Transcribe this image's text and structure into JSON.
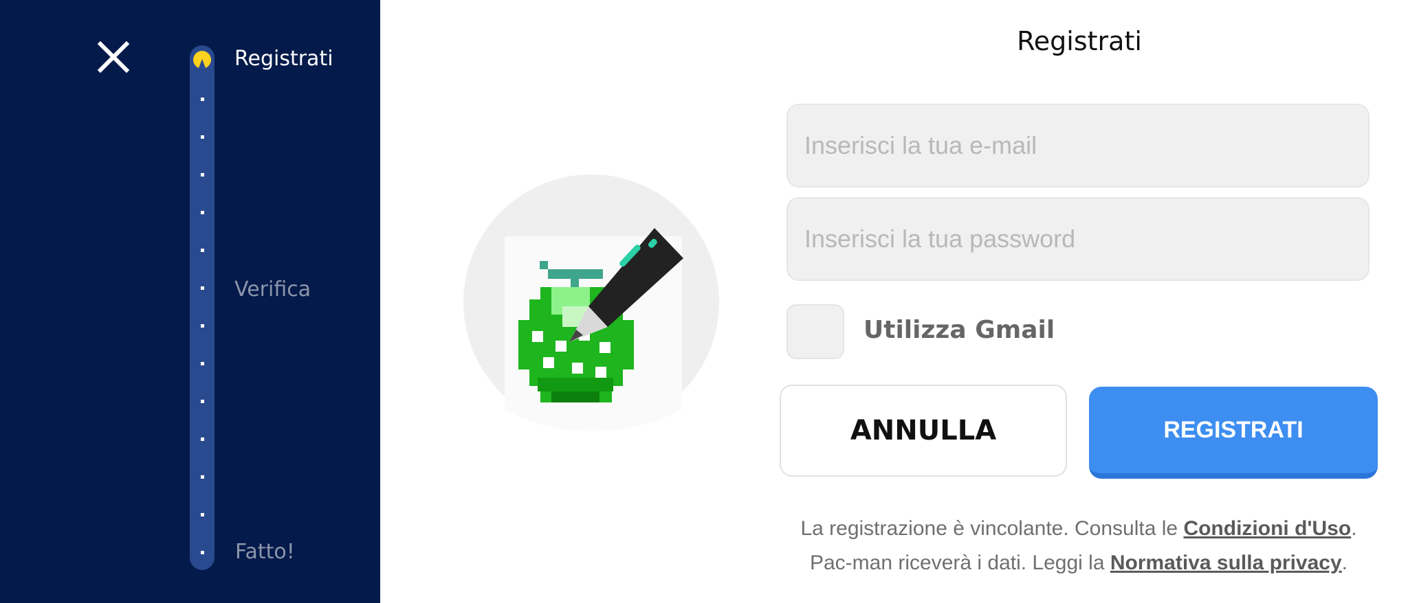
{
  "colors": {
    "sidebar_bg": "#041a4a",
    "track": "#2a4a8f",
    "pacman": "#ffd21f",
    "primary_button": "#3d8ef0",
    "field_bg": "#f0f0f0"
  },
  "sidebar": {
    "close_icon": "close-icon",
    "steps": [
      {
        "label": "Registrati",
        "state": "active"
      },
      {
        "label": "Verifica",
        "state": "pending"
      },
      {
        "label": "Fatto!",
        "state": "pending"
      }
    ]
  },
  "main": {
    "title": "Registrati",
    "illustration_icon": "pixel-melon-with-pen-icon",
    "form": {
      "email_placeholder": "Inserisci la tua e-mail",
      "email_value": "",
      "password_placeholder": "Inserisci la tua password",
      "password_value": "",
      "gmail_label": "Utilizza Gmail",
      "gmail_checked": false
    },
    "buttons": {
      "cancel": "ANNULLA",
      "submit": "REGISTRATI"
    },
    "legal": {
      "line1_text": "La registrazione è vincolante. Consulta le ",
      "line1_link": "Condizioni d'Uso",
      "line1_end": ".",
      "line2_text": "Pac-man riceverà i dati. Leggi la ",
      "line2_link": "Normativa sulla privacy",
      "line2_end": "."
    }
  }
}
